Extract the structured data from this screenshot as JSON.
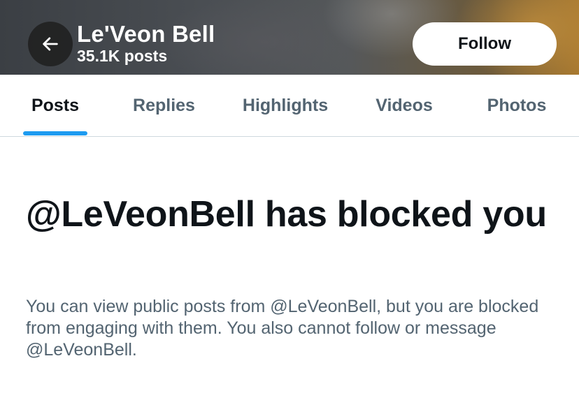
{
  "header": {
    "profile_name": "Le'Veon Bell",
    "post_count": "35.1K posts",
    "follow_label": "Follow",
    "back_icon": "arrow-left-icon"
  },
  "tabs": [
    {
      "label": "Posts",
      "active": true
    },
    {
      "label": "Replies",
      "active": false
    },
    {
      "label": "Highlights",
      "active": false
    },
    {
      "label": "Videos",
      "active": false
    },
    {
      "label": "Photos",
      "active": false
    }
  ],
  "blocked": {
    "title": "@LeVeonBell has blocked you",
    "description": "You can view public posts from @LeVeonBell, but you are blocked from engaging with them. You also cannot follow or message @LeVeonBell."
  },
  "colors": {
    "accent": "#1d9bf0",
    "text_primary": "#0f1419",
    "text_secondary": "#536471",
    "divider": "#cfd9de"
  }
}
